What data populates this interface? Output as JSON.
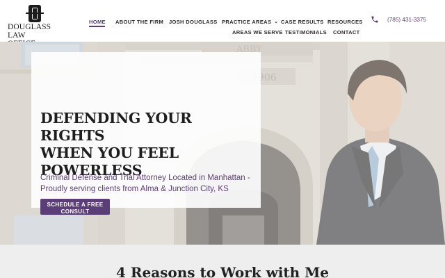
{
  "logo": {
    "line1": "DOUGLASS",
    "line2": "LAW OFFICE"
  },
  "nav": {
    "items": [
      {
        "label": "HOME",
        "active": true
      },
      {
        "label": "ABOUT THE FIRM"
      },
      {
        "label": "JOSH DOUGLASS"
      },
      {
        "label": "PRACTICE AREAS",
        "has_dropdown": true
      },
      {
        "label": "CASE RESULTS"
      },
      {
        "label": "RESOURCES"
      },
      {
        "label": "AREAS WE SERVE"
      },
      {
        "label": "TESTIMONIALS"
      },
      {
        "label": "CONTACT"
      }
    ],
    "caret": "⌄"
  },
  "contact": {
    "phone": "(785) 431-3375",
    "icon": "phone-icon"
  },
  "hero": {
    "building_inscription": "1906",
    "building_sign": "ABBY",
    "title_line1": "DEFENDING YOUR RIGHTS",
    "title_line2": "WHEN YOU FEEL",
    "title_line3": "POWERLESS",
    "subtitle": "Criminal Defense and Trial Attorney Located in Manhattan - Proudly serving clients from Alma & Junction City, KS",
    "cta_label": "SCHEDULE A FREE CONSULT"
  },
  "reasons": {
    "title": "4 Reasons to Work with Me"
  },
  "colors": {
    "accent": "#5b3d77",
    "text": "#222222",
    "section_bg": "#eeeeee"
  }
}
